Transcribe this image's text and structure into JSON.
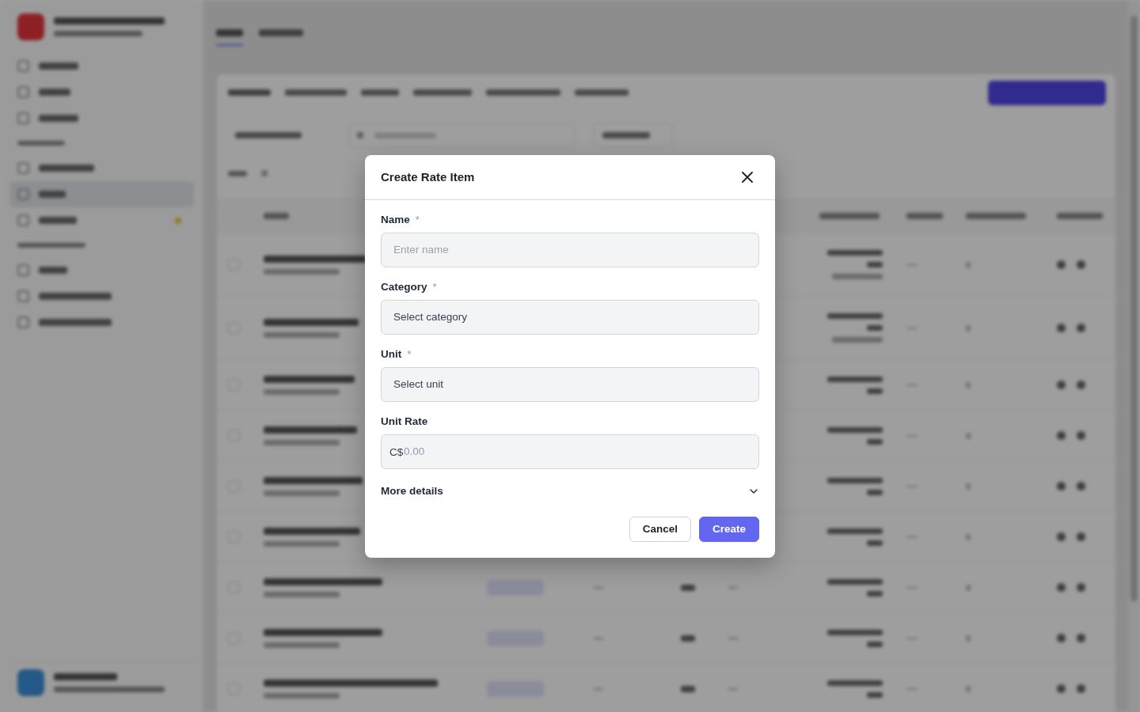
{
  "dialog": {
    "title": "Create Rate Item",
    "fields": [
      {
        "kind": "text",
        "label": "Name",
        "required_mark": "*",
        "placeholder": "Enter name"
      },
      {
        "kind": "select",
        "label": "Category",
        "required_mark": "*",
        "value": "Select category"
      },
      {
        "kind": "select",
        "label": "Unit",
        "required_mark": "*",
        "value": "Select unit"
      },
      {
        "kind": "currency",
        "label": "Unit Rate",
        "prefix": "C$",
        "placeholder": "0.00"
      }
    ],
    "more_details": {
      "label": "More details",
      "expanded": false
    },
    "buttons": [
      {
        "kind": "secondary",
        "label": "Cancel"
      },
      {
        "kind": "primary",
        "label": "Create"
      }
    ]
  }
}
